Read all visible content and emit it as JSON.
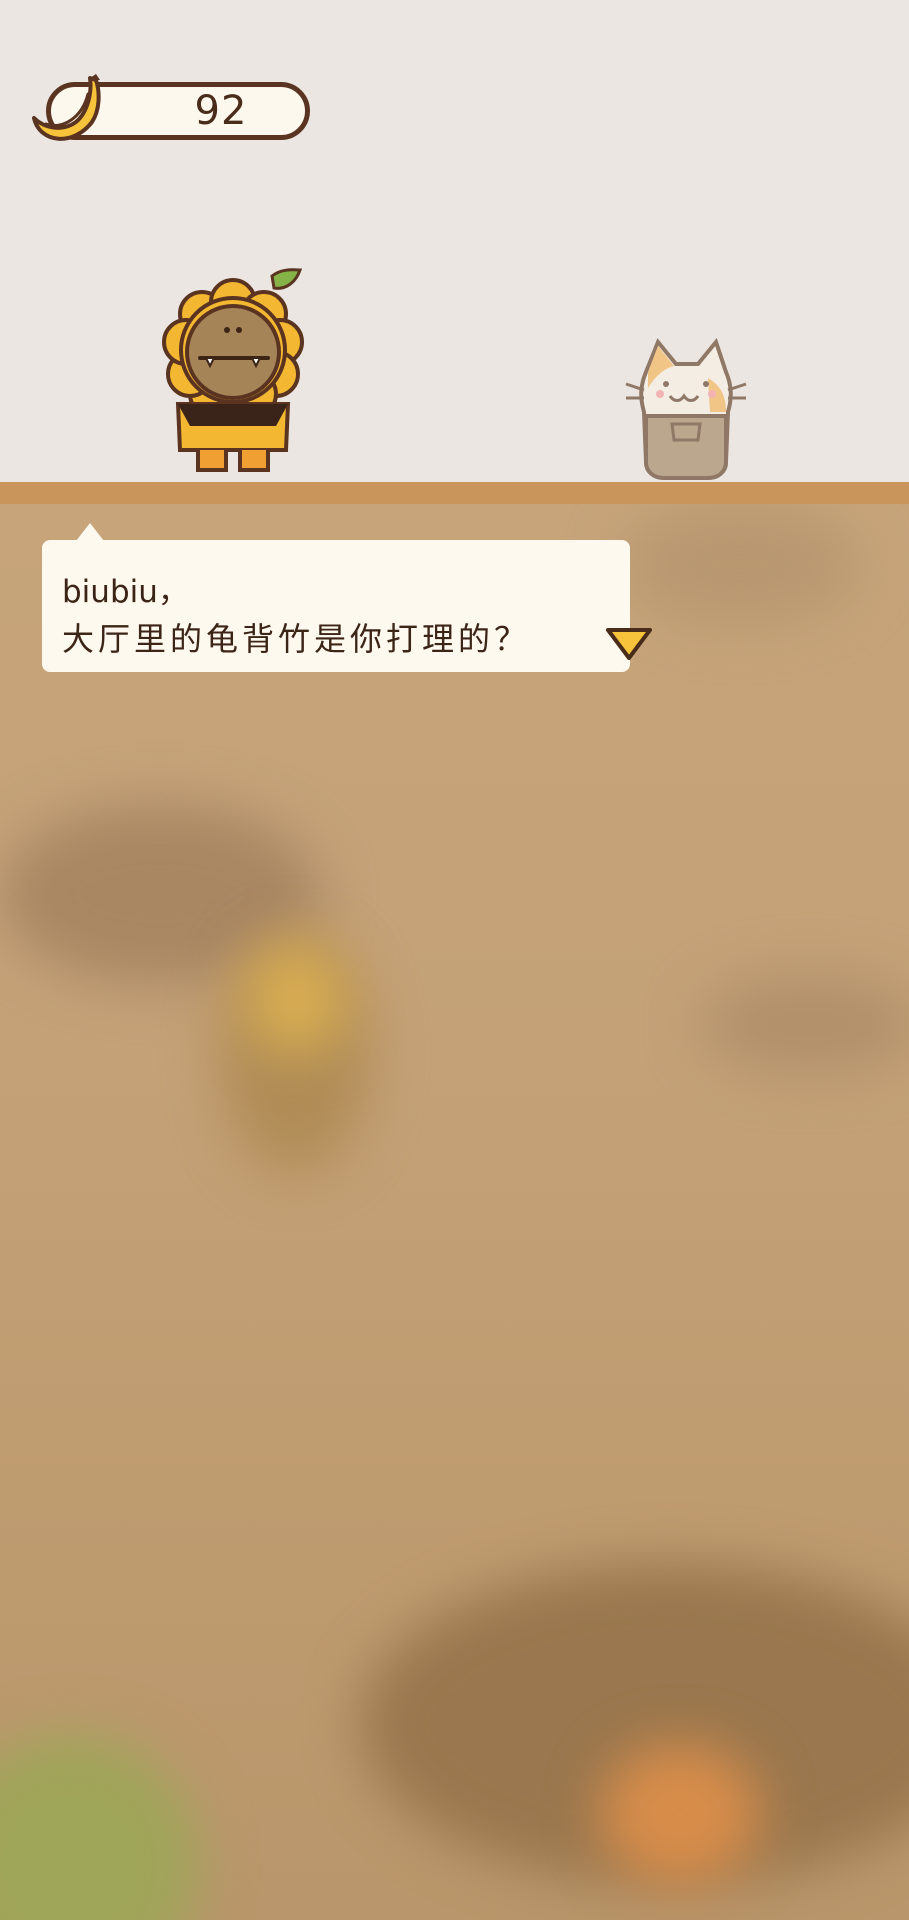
{
  "counter": {
    "value": "92",
    "icon": "banana-icon"
  },
  "dialog": {
    "speaker_line": "biubiu，",
    "message": "大厅里的龟背竹是你打理的？",
    "next_icon": "triangle-down-icon"
  },
  "characters": {
    "left": "sunflower-character",
    "right": "cat-character"
  },
  "colors": {
    "top_background": "#ebe6e1",
    "floor_strip": "#c9955b",
    "lower_background": "#c4a177",
    "dialog_background": "#fdf9ef",
    "text": "#3c2416",
    "accent_yellow": "#f6c33a"
  }
}
